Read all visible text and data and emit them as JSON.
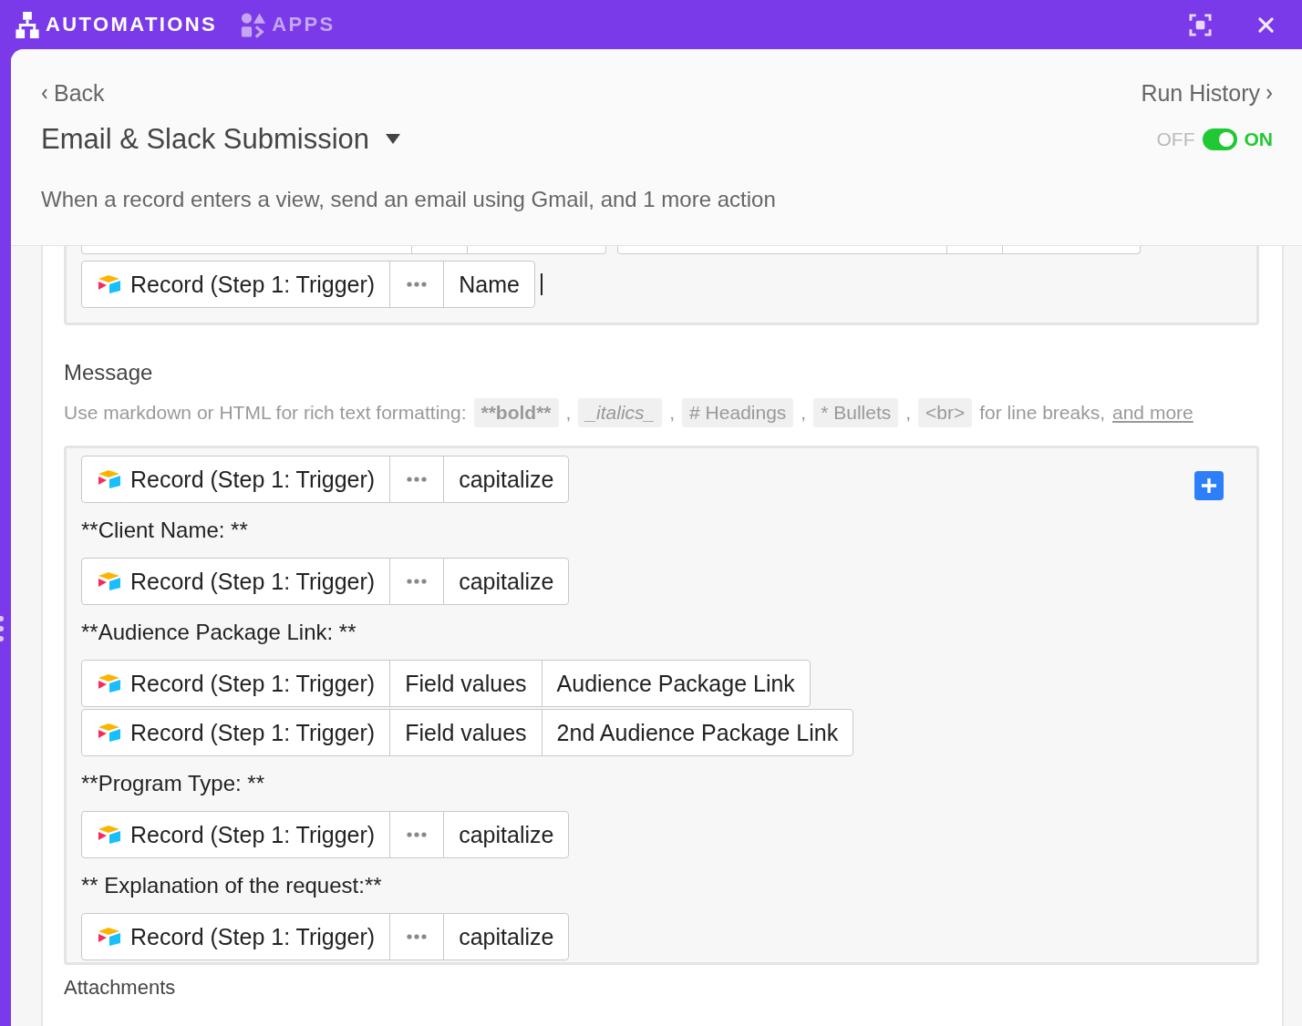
{
  "topbar": {
    "tabs": [
      {
        "label": "AUTOMATIONS",
        "kind": "automations",
        "selected": true
      },
      {
        "label": "APPS",
        "kind": "apps",
        "selected": false
      }
    ]
  },
  "header": {
    "back": "Back",
    "run_history": "Run History",
    "title": "Email & Slack Submission",
    "description": "When a record enters a view, send an email using Gmail, and 1 more action",
    "toggle": {
      "off_label": "OFF",
      "on_label": "ON",
      "on": true
    }
  },
  "subject": {
    "tokens": [
      {
        "source": "Record (Step 1: Trigger)",
        "segments": [
          {
            "kind": "more"
          },
          {
            "kind": "text",
            "text": "Name"
          }
        ]
      }
    ],
    "cursor": true
  },
  "message": {
    "label": "Message",
    "help": [
      {
        "kind": "text",
        "text": "Use markdown or HTML for rich text formatting:"
      },
      {
        "kind": "code_bold",
        "text": "**bold**"
      },
      {
        "kind": "text",
        "text": ","
      },
      {
        "kind": "code_italic",
        "text": "_italics_"
      },
      {
        "kind": "text",
        "text": ","
      },
      {
        "kind": "code",
        "text": "# Headings"
      },
      {
        "kind": "text",
        "text": ","
      },
      {
        "kind": "code",
        "text": "* Bullets"
      },
      {
        "kind": "text",
        "text": ","
      },
      {
        "kind": "code",
        "text": "<br>"
      },
      {
        "kind": "text",
        "text": "for line breaks,"
      },
      {
        "kind": "link",
        "text": "and more"
      }
    ],
    "items": [
      {
        "kind": "token",
        "source": "Record (Step 1: Trigger)",
        "segments": [
          {
            "kind": "more"
          },
          {
            "kind": "text",
            "text": "capitalize"
          }
        ]
      },
      {
        "kind": "text",
        "text": "**Client Name: **"
      },
      {
        "kind": "token",
        "source": "Record (Step 1: Trigger)",
        "segments": [
          {
            "kind": "more"
          },
          {
            "kind": "text",
            "text": "capitalize"
          }
        ]
      },
      {
        "kind": "text",
        "text": "**Audience Package Link: **"
      },
      {
        "kind": "token",
        "source": "Record (Step 1: Trigger)",
        "segments": [
          {
            "kind": "text",
            "text": "Field values"
          },
          {
            "kind": "text",
            "text": "Audience Package Link"
          }
        ]
      },
      {
        "kind": "token",
        "source": "Record (Step 1: Trigger)",
        "segments": [
          {
            "kind": "text",
            "text": "Field values"
          },
          {
            "kind": "text",
            "text": "2nd Audience Package Link"
          }
        ]
      },
      {
        "kind": "text",
        "text": "**Program Type: **"
      },
      {
        "kind": "token",
        "source": "Record (Step 1: Trigger)",
        "segments": [
          {
            "kind": "more"
          },
          {
            "kind": "text",
            "text": "capitalize"
          }
        ]
      },
      {
        "kind": "text",
        "text": "** Explanation of the request:**"
      },
      {
        "kind": "token",
        "source": "Record (Step 1: Trigger)",
        "segments": [
          {
            "kind": "more"
          },
          {
            "kind": "text",
            "text": "capitalize"
          }
        ]
      }
    ]
  },
  "attachments": {
    "label": "Attachments"
  }
}
